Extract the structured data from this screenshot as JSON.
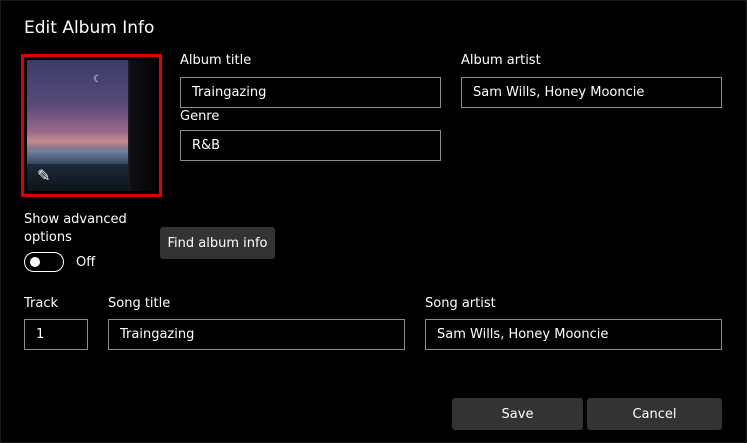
{
  "dialog": {
    "title": "Edit Album Info"
  },
  "album": {
    "title_label": "Album title",
    "title_value": "Traingazing",
    "artist_label": "Album artist",
    "artist_value": "Sam Wills, Honey Mooncie",
    "genre_label": "Genre",
    "genre_value": "R&B"
  },
  "advanced": {
    "label": "Show advanced options",
    "toggle_state": "Off"
  },
  "find_button": "Find album info",
  "track": {
    "number_label": "Track",
    "number_value": "1",
    "song_title_label": "Song title",
    "song_title_value": "Traingazing",
    "song_artist_label": "Song artist",
    "song_artist_value": "Sam Wills, Honey Mooncie"
  },
  "buttons": {
    "save": "Save",
    "cancel": "Cancel"
  },
  "icons": {
    "edit": "pencil-icon",
    "moon": "moon-icon"
  },
  "colors": {
    "selection_border": "#e10000",
    "button_bg": "#333333",
    "field_border": "#8a8a8a"
  }
}
